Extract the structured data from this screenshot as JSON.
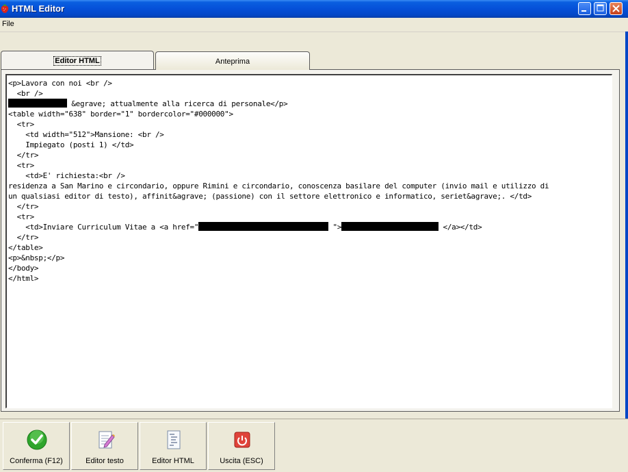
{
  "window": {
    "title": "HTML Editor"
  },
  "menu": {
    "file": "File"
  },
  "tabs": {
    "editor": "Editor HTML",
    "preview": "Anteprima"
  },
  "code": {
    "l1": "<p>Lavora con noi <br />",
    "l2": "  <br />",
    "l3": " &egrave; attualmente alla ricerca di personale</p>",
    "l4": "<table width=\"638\" border=\"1\" bordercolor=\"#000000\">",
    "l5": "  <tr>",
    "l6": "    <td width=\"512\">Mansione: <br />",
    "l7": "    Impiegato (posti 1) </td>",
    "l8": "  </tr>",
    "l9": "  <tr>",
    "l10": "    <td>E' richiesta:<br />",
    "l11": "residenza a San Marino e circondario, oppure Rimini e circondario, conoscenza basilare del computer (invio mail e utilizzo di",
    "l12": "un qualsiasi editor di testo), affinit&agrave; (passione) con il settore elettronico e informatico, seriet&agrave;. </td>",
    "l13": "  </tr>",
    "l14": "  <tr>",
    "l15a": "    <td>Inviare Curriculum Vitae a <a href=\"",
    "l15b": " \">",
    "l15c": " </a></td>",
    "l16": "  </tr>",
    "l17": "</table>",
    "l18": "<p>&nbsp;</p>",
    "l19": "</body>",
    "l20": "</html>"
  },
  "toolbar": {
    "confirm": "Conferma (F12)",
    "text_editor": "Editor testo",
    "html_editor": "Editor HTML",
    "exit": "Uscita (ESC)"
  }
}
